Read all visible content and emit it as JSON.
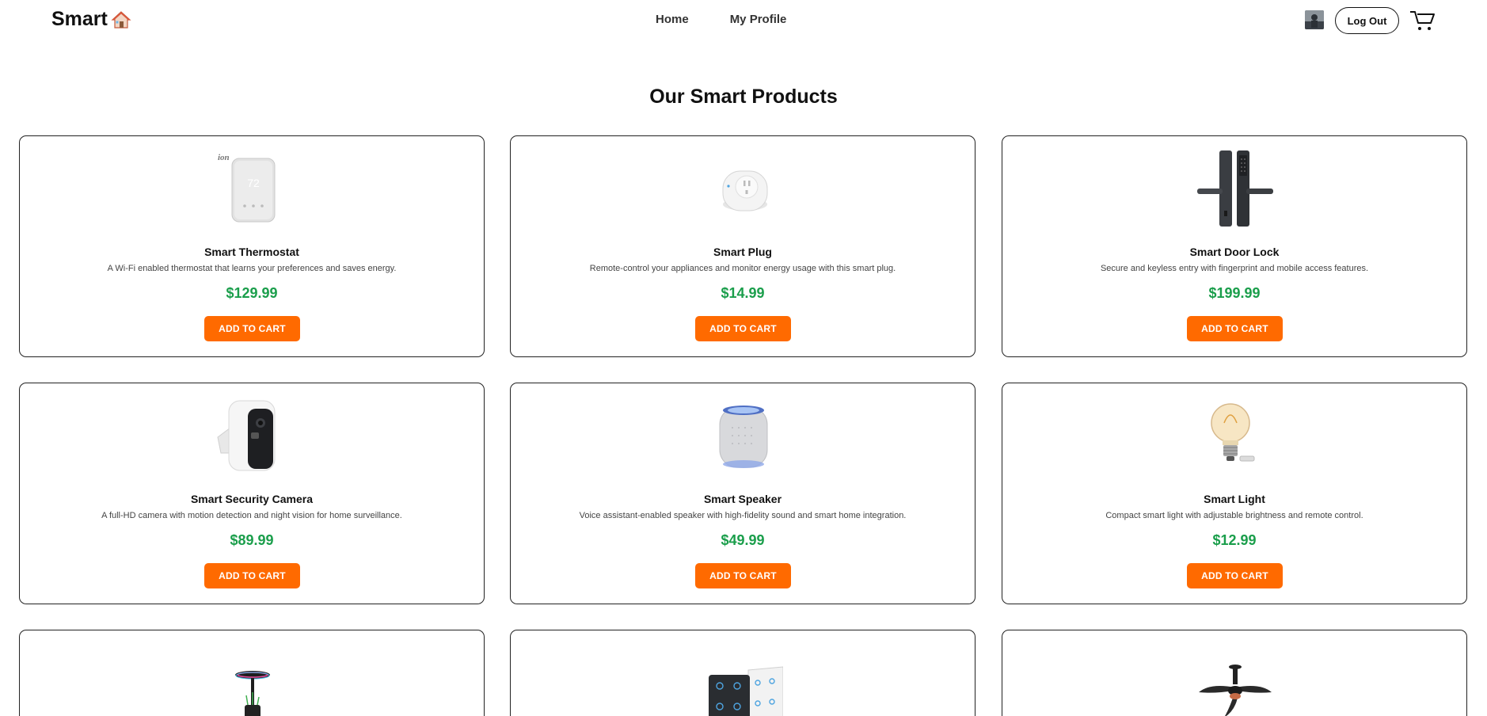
{
  "nav": {
    "logo_text": "Smart",
    "logo_icon": "house-icon",
    "links": [
      "Home",
      "My Profile"
    ],
    "logout_label": "Log Out",
    "cart_icon": "cart-icon",
    "avatar_icon": "avatar"
  },
  "heading": "Our Smart Products",
  "colors": {
    "accent": "#ff6a00",
    "price": "#1a9e4b",
    "border": "#222222"
  },
  "products": [
    {
      "name": "Smart Thermostat",
      "desc": "A Wi-Fi enabled thermostat that learns your preferences and saves energy.",
      "price": "$129.99",
      "button": "ADD TO CART",
      "icon": "thermostat-image"
    },
    {
      "name": "Smart Plug",
      "desc": "Remote-control your appliances and monitor energy usage with this smart plug.",
      "price": "$14.99",
      "button": "ADD TO CART",
      "icon": "plug-image"
    },
    {
      "name": "Smart Door Lock",
      "desc": "Secure and keyless entry with fingerprint and mobile access features.",
      "price": "$199.99",
      "button": "ADD TO CART",
      "icon": "door-lock-image"
    },
    {
      "name": "Smart Security Camera",
      "desc": "A full-HD camera with motion detection and night vision for home surveillance.",
      "price": "$89.99",
      "button": "ADD TO CART",
      "icon": "camera-image"
    },
    {
      "name": "Smart Speaker",
      "desc": "Voice assistant-enabled speaker with high-fidelity sound and smart home integration.",
      "price": "$49.99",
      "button": "ADD TO CART",
      "icon": "speaker-image"
    },
    {
      "name": "Smart Light",
      "desc": "Compact smart light with adjustable brightness and remote control.",
      "price": "$12.99",
      "button": "ADD TO CART",
      "icon": "light-bulb-image"
    }
  ],
  "partial_products": [
    {
      "icon": "lamp-image"
    },
    {
      "icon": "switch-panel-image"
    },
    {
      "icon": "ceiling-fan-image"
    }
  ]
}
